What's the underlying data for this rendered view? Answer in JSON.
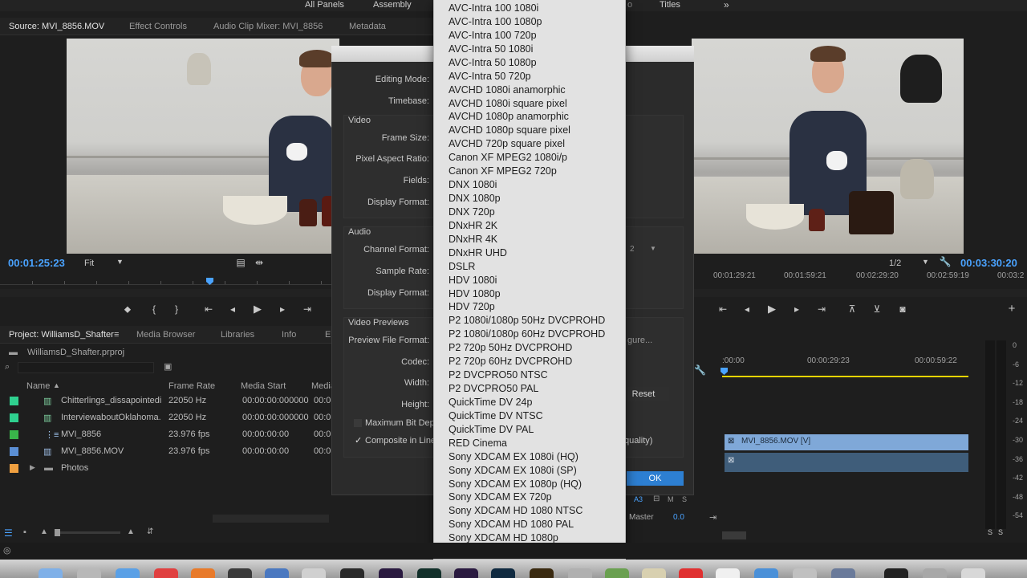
{
  "workspace": {
    "tabs": [
      "All Panels",
      "Assembly",
      "Titles"
    ],
    "more_icon": "double-chevron-right-icon",
    "partial_tab": "o"
  },
  "source_monitor": {
    "tabs": [
      "Source: MVI_8856.MOV",
      "Effect Controls",
      "Audio Clip Mixer: MVI_8856",
      "Metadata"
    ],
    "timecode": "00:01:25:23",
    "zoom": "Fit"
  },
  "program_monitor": {
    "resolution": "1/2",
    "timecode": "00:03:30:20",
    "ruler": [
      "00:01:29:21",
      "00:01:59:21",
      "00:02:29:20",
      "00:02:59:19",
      "00:03:2"
    ]
  },
  "project": {
    "tabs": [
      "Project: WilliamsD_Shafter",
      "Media Browser",
      "Libraries",
      "Info",
      "E"
    ],
    "file": "WilliamsD_Shafter.prproj",
    "columns": [
      "Name",
      "Frame Rate",
      "Media Start",
      "Media"
    ],
    "rows": [
      {
        "name": "Chitterlings_dissapointedi",
        "rate": "22050 Hz",
        "start": "00:00:00:000000",
        "end": "00:0",
        "color": "#2fd08f"
      },
      {
        "name": "InterviewaboutOklahoma.",
        "rate": "22050 Hz",
        "start": "00:00:00:000000",
        "end": "00:0",
        "color": "#2fd08f"
      },
      {
        "name": "MVI_8856",
        "rate": "23.976 fps",
        "start": "00:00:00:00",
        "end": "00:0",
        "color": "#39b54a"
      },
      {
        "name": "MVI_8856.MOV",
        "rate": "23.976 fps",
        "start": "00:00:00:00",
        "end": "00:0",
        "color": "#5b8fd4"
      },
      {
        "name": "Photos",
        "rate": "",
        "start": "",
        "end": "",
        "color": "#f0a040"
      }
    ]
  },
  "dialog": {
    "labels": {
      "editing_mode": "Editing Mode:",
      "timebase": "Timebase:",
      "video": "Video",
      "frame_size": "Frame Size:",
      "pixel_aspect": "Pixel Aspect Ratio:",
      "fields": "Fields:",
      "display_format": "Display Format:",
      "audio": "Audio",
      "channel_format": "Channel Format:",
      "sample_rate": "Sample Rate:",
      "audio_display_format": "Display Format:",
      "video_previews": "Video Previews",
      "preview_format": "Preview File Format:",
      "codec": "Codec:",
      "width": "Width:",
      "height": "Height:",
      "max_bit_depth": "Maximum Bit Dept",
      "composite": "Composite in Line",
      "quality_suffix": "quality)",
      "configure": "gure...",
      "channel_value": "2"
    },
    "reset_label": "Reset",
    "ok_label": "OK"
  },
  "dropdown": {
    "items": [
      "AVC-Intra 100 1080i",
      "AVC-Intra 100 1080p",
      "AVC-Intra 100 720p",
      "AVC-Intra 50 1080i",
      "AVC-Intra 50 1080p",
      "AVC-Intra 50 720p",
      "AVCHD 1080i anamorphic",
      "AVCHD 1080i square pixel",
      "AVCHD 1080p anamorphic",
      "AVCHD 1080p square pixel",
      "AVCHD 720p square pixel",
      "Canon XF MPEG2 1080i/p",
      "Canon XF MPEG2 720p",
      "DNX 1080i",
      "DNX 1080p",
      "DNX 720p",
      "DNxHR 2K",
      "DNxHR 4K",
      "DNxHR UHD",
      "DSLR",
      "HDV 1080i",
      "HDV 1080p",
      "HDV 720p",
      "P2 1080i/1080p 50Hz DVCPROHD",
      "P2 1080i/1080p 60Hz DVCPROHD",
      "P2 720p 50Hz DVCPROHD",
      "P2 720p 60Hz DVCPROHD",
      "P2 DVCPRO50 NTSC",
      "P2 DVCPRO50 PAL",
      "QuickTime DV 24p",
      "QuickTime DV NTSC",
      "QuickTime DV PAL",
      "RED Cinema",
      "Sony XDCAM EX 1080i (HQ)",
      "Sony XDCAM EX 1080i (SP)",
      "Sony XDCAM EX 1080p (HQ)",
      "Sony XDCAM EX 720p",
      "Sony XDCAM HD 1080 NTSC",
      "Sony XDCAM HD 1080 PAL",
      "Sony XDCAM HD 1080p"
    ]
  },
  "timeline": {
    "ruler": [
      ":00:00",
      "00:00:29:23",
      "00:00:59:22"
    ],
    "clip_label": "MVI_8856.MOV [V]",
    "track_label": "A3",
    "master_label": "Master",
    "master_value": "0.0",
    "m_label": "M",
    "s_label": "S"
  },
  "meter": {
    "labels": [
      "0",
      "-6",
      "-12",
      "-18",
      "-24",
      "-30",
      "-36",
      "-42",
      "-48",
      "-54"
    ],
    "footer": [
      "S",
      "S"
    ]
  },
  "colors": {
    "accent": "#4aa3ff",
    "dialog_bg": "#2b2b2b",
    "dropdown_bg": "#e2e2e2",
    "ok_button": "#2d7fd2",
    "clip_video": "#7fa8d8",
    "clip_audio": "#3f5d7a",
    "timeline_yellow": "#e6d400"
  }
}
